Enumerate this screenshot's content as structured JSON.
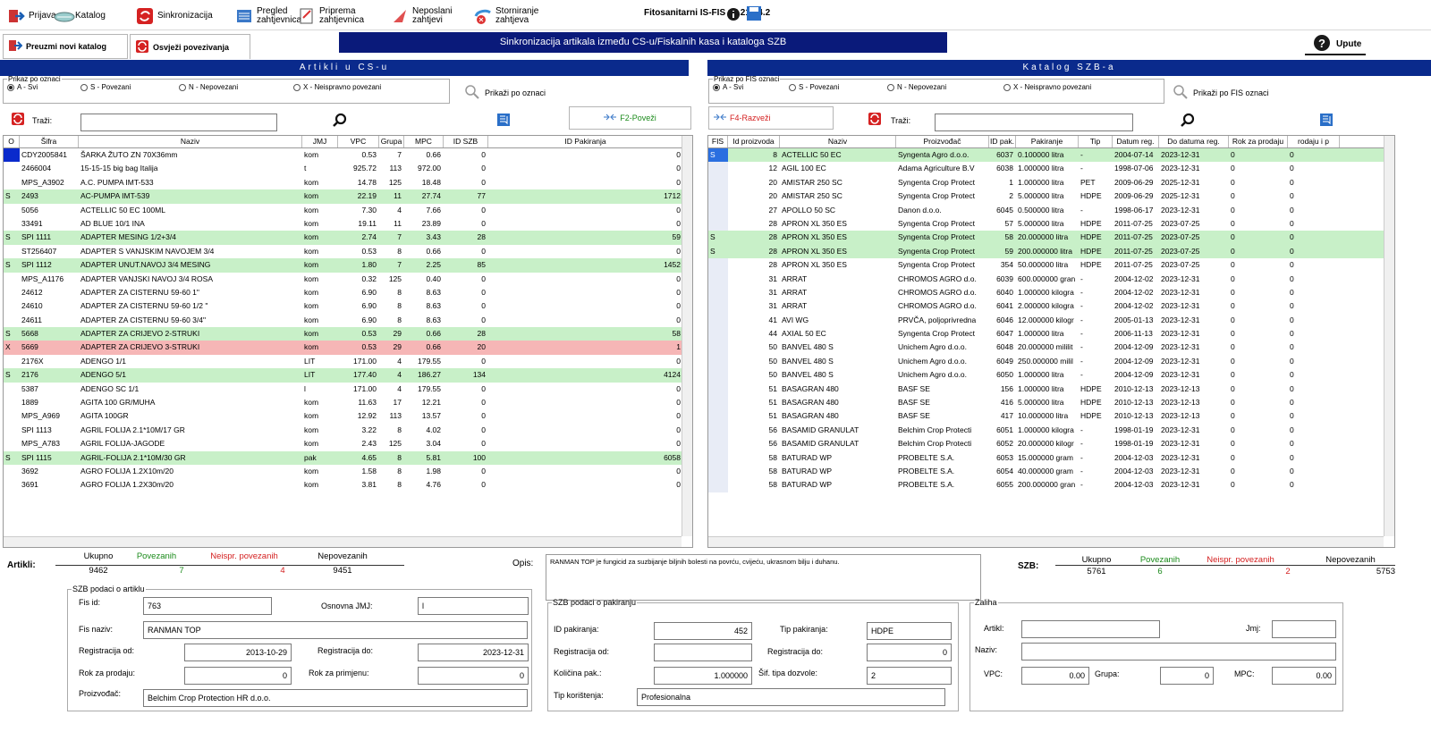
{
  "toolbar": {
    "items": [
      {
        "label": "Prijava",
        "icon": "login-icon"
      },
      {
        "label": "Katalog",
        "icon": "catalog-icon"
      },
      {
        "label": "Sinkronizacija",
        "icon": "sync-icon"
      },
      {
        "label": "Pregled\nzahtjevnica",
        "icon": "review-icon"
      },
      {
        "label": "Priprema\nzahtjevnica",
        "icon": "prepare-icon"
      },
      {
        "label": "Neposlani\nzahtjevi",
        "icon": "unsent-icon"
      },
      {
        "label": "Storniranje\nzahtjeva",
        "icon": "cancel-icon"
      }
    ],
    "app_title": "Fitosanitarni IS-FIS v5.21.04.2"
  },
  "actions": {
    "download_catalog": "Preuzmi novi katalog",
    "refresh_links": "Osvježi povezivanja",
    "help": "Upute"
  },
  "banner": "Sinkronizacija artikala između CS-u/Fiskalnih kasa i kataloga SZB",
  "left": {
    "title": "Artikli u CS-u",
    "filter_legend": "Prikaz po oznaci",
    "radios": [
      "A - Svi",
      "S - Povezani",
      "N - Nepovezani",
      "X - Neispravno povezani"
    ],
    "show_by": "Prikaži po oznaci",
    "search_label": "Traži:",
    "link_button": "F2-Poveži",
    "columns": [
      "O",
      "Šifra",
      "Naziv",
      "JMJ",
      "VPC",
      "Grupa",
      "MPC",
      "ID SZB",
      "ID Pakiranja"
    ],
    "rows": [
      [
        "",
        "CDY2005841",
        "ŠARKA ŽUTO ZN 70X36mm",
        "kom",
        "0.53",
        "7",
        "0.66",
        "0",
        "0"
      ],
      [
        "",
        "2466004",
        "15-15-15 big bag Italija",
        "t",
        "925.72",
        "113",
        "972.00",
        "0",
        "0"
      ],
      [
        "",
        "MPS_A3902",
        "A.C. PUMPA IMT-533",
        "kom",
        "14.78",
        "125",
        "18.48",
        "0",
        "0"
      ],
      [
        "S",
        "2493",
        "AC-PUMPA IMT-539",
        "kom",
        "22.19",
        "11",
        "27.74",
        "77",
        "1712"
      ],
      [
        "",
        "5056",
        "ACTELLIC 50 EC 100ML",
        "kom",
        "7.30",
        "4",
        "7.66",
        "0",
        "0"
      ],
      [
        "",
        "33491",
        "AD BLUE 10/1  INA",
        "kom",
        "19.11",
        "11",
        "23.89",
        "0",
        "0"
      ],
      [
        "S",
        "SPI 1111",
        "ADAPTER MESING 1/2+3/4",
        "kom",
        "2.74",
        "7",
        "3.43",
        "28",
        "59"
      ],
      [
        "",
        "ST256407",
        "ADAPTER S VANJSKIM NAVOJEM 3/4",
        "kom",
        "0.53",
        "8",
        "0.66",
        "0",
        "0"
      ],
      [
        "S",
        "SPI 1112",
        "ADAPTER UNUT.NAVOJ 3/4 MESING",
        "kom",
        "1.80",
        "7",
        "2.25",
        "85",
        "1452"
      ],
      [
        "",
        "MPS_A1176",
        "ADAPTER VANJSKI NAVOJ 3/4 ROSA",
        "kom",
        "0.32",
        "125",
        "0.40",
        "0",
        "0"
      ],
      [
        "",
        "24612",
        "ADAPTER ZA CISTERNU  59-60  1\"",
        "kom",
        "6.90",
        "8",
        "8.63",
        "0",
        "0"
      ],
      [
        "",
        "24610",
        "ADAPTER ZA CISTERNU  59-60  1/2 \"",
        "kom",
        "6.90",
        "8",
        "8.63",
        "0",
        "0"
      ],
      [
        "",
        "24611",
        "ADAPTER ZA CISTERNU 59-60  3/4\"",
        "kom",
        "6.90",
        "8",
        "8.63",
        "0",
        "0"
      ],
      [
        "S",
        "5668",
        "ADAPTER ZA CRIJEVO 2-STRUKI",
        "kom",
        "0.53",
        "29",
        "0.66",
        "28",
        "58"
      ],
      [
        "X",
        "5669",
        "ADAPTER ZA CRIJEVO 3-STRUKI",
        "kom",
        "0.53",
        "29",
        "0.66",
        "20",
        "1"
      ],
      [
        "",
        "2176X",
        "ADENGO  1/1",
        "LIT",
        "171.00",
        "4",
        "179.55",
        "0",
        "0"
      ],
      [
        "S",
        "2176",
        "ADENGO 5/1",
        "LIT",
        "177.40",
        "4",
        "186.27",
        "134",
        "4124"
      ],
      [
        "",
        "5387",
        "ADENGO SC 1/1",
        "l",
        "171.00",
        "4",
        "179.55",
        "0",
        "0"
      ],
      [
        "",
        "1889",
        "AGITA 100 GR/MUHA",
        "kom",
        "11.63",
        "17",
        "12.21",
        "0",
        "0"
      ],
      [
        "",
        "MPS_A969",
        "AGITA 100GR",
        "kom",
        "12.92",
        "113",
        "13.57",
        "0",
        "0"
      ],
      [
        "",
        "SPI 1113",
        "AGRIL FOLIJA 2.1*10M/17 GR",
        "kom",
        "3.22",
        "8",
        "4.02",
        "0",
        "0"
      ],
      [
        "",
        "MPS_A783",
        "AGRIL FOLIJA-JAGODE",
        "kom",
        "2.43",
        "125",
        "3.04",
        "0",
        "0"
      ],
      [
        "S",
        "SPI 1115",
        "AGRIL-FOLIJA 2.1*10M/30 GR",
        "pak",
        "4.65",
        "8",
        "5.81",
        "100",
        "6058"
      ],
      [
        "",
        "3692",
        "AGRO FOLIJA 1.2X10m/20",
        "kom",
        "1.58",
        "8",
        "1.98",
        "0",
        "0"
      ],
      [
        "",
        "3691",
        "AGRO FOLIJA 1.2X30m/20",
        "kom",
        "3.81",
        "8",
        "4.76",
        "0",
        "0"
      ]
    ],
    "stats": {
      "label": "Artikli:",
      "h": [
        "Ukupno",
        "Povezanih",
        "Neispr. povezanih",
        "Nepovezanih"
      ],
      "v": [
        "9462",
        "7",
        "4",
        "9451"
      ]
    }
  },
  "right": {
    "title": "Katalog SZB-a",
    "filter_legend": "Prikaz po FIS oznaci",
    "radios": [
      "A - Svi",
      "S - Povezani",
      "N - Nepovezani",
      "X - Neispravno povezani"
    ],
    "show_by": "Prikaži po FIS oznaci",
    "unlink_button": "F4-Razveži",
    "search_label": "Traži:",
    "columns": [
      "FIS",
      "Id proizvoda",
      "Naziv",
      "Proizvođač",
      "ID pak.",
      "Pakiranje",
      "Tip",
      "Datum reg.",
      "Do datuma reg.",
      "Rok za prodaju",
      "rodaju i p"
    ],
    "rows": [
      [
        "S",
        "8",
        "ACTELLIC 50 EC",
        "Syngenta Agro d.o.o.",
        "6037",
        "0.100000 litra",
        "-",
        "2004-07-14",
        "2023-12-31",
        "0",
        "0"
      ],
      [
        "",
        "12",
        "AGIL 100 EC",
        "Adama Agriculture B.V",
        "6038",
        "1.000000 litra",
        "-",
        "1998-07-06",
        "2023-12-31",
        "0",
        "0"
      ],
      [
        "",
        "20",
        "AMISTAR 250 SC",
        "Syngenta Crop Protect",
        "1",
        "1.000000 litra",
        "PET",
        "2009-06-29",
        "2025-12-31",
        "0",
        "0"
      ],
      [
        "",
        "20",
        "AMISTAR 250 SC",
        "Syngenta Crop Protect",
        "2",
        "5.000000 litra",
        "HDPE",
        "2009-06-29",
        "2025-12-31",
        "0",
        "0"
      ],
      [
        "",
        "27",
        "APOLLO 50 SC",
        "Danon d.o.o.",
        "6045",
        "0.500000 litra",
        "-",
        "1998-06-17",
        "2023-12-31",
        "0",
        "0"
      ],
      [
        "",
        "28",
        "APRON XL 350 ES",
        "Syngenta Crop Protect",
        "57",
        "5.000000 litra",
        "HDPE",
        "2011-07-25",
        "2023-07-25",
        "0",
        "0"
      ],
      [
        "S",
        "28",
        "APRON XL 350 ES",
        "Syngenta Crop Protect",
        "58",
        "20.000000 litra",
        "HDPE",
        "2011-07-25",
        "2023-07-25",
        "0",
        "0"
      ],
      [
        "S",
        "28",
        "APRON XL 350 ES",
        "Syngenta Crop Protect",
        "59",
        "200.000000 litra",
        "HDPE",
        "2011-07-25",
        "2023-07-25",
        "0",
        "0"
      ],
      [
        "",
        "28",
        "APRON XL 350 ES",
        "Syngenta Crop Protect",
        "354",
        "50.000000 litra",
        "HDPE",
        "2011-07-25",
        "2023-07-25",
        "0",
        "0"
      ],
      [
        "",
        "31",
        "ARRAT",
        "CHROMOS AGRO d.o.",
        "6039",
        "600.000000 gran",
        "-",
        "2004-12-02",
        "2023-12-31",
        "0",
        "0"
      ],
      [
        "",
        "31",
        "ARRAT",
        "CHROMOS AGRO d.o.",
        "6040",
        "1.000000 kilogra",
        "-",
        "2004-12-02",
        "2023-12-31",
        "0",
        "0"
      ],
      [
        "",
        "31",
        "ARRAT",
        "CHROMOS AGRO d.o.",
        "6041",
        "2.000000 kilogra",
        "-",
        "2004-12-02",
        "2023-12-31",
        "0",
        "0"
      ],
      [
        "",
        "41",
        "AVI WG",
        "PRVČA, poljoprivredna",
        "6046",
        "12.000000 kilogr",
        "-",
        "2005-01-13",
        "2023-12-31",
        "0",
        "0"
      ],
      [
        "",
        "44",
        "AXIAL 50 EC",
        "Syngenta Crop Protect",
        "6047",
        "1.000000 litra",
        "-",
        "2006-11-13",
        "2023-12-31",
        "0",
        "0"
      ],
      [
        "",
        "50",
        "BANVEL 480 S",
        "Unichem Agro d.o.o.",
        "6048",
        "20.000000 mililit",
        "-",
        "2004-12-09",
        "2023-12-31",
        "0",
        "0"
      ],
      [
        "",
        "50",
        "BANVEL 480 S",
        "Unichem Agro d.o.o.",
        "6049",
        "250.000000 milil",
        "-",
        "2004-12-09",
        "2023-12-31",
        "0",
        "0"
      ],
      [
        "",
        "50",
        "BANVEL 480 S",
        "Unichem Agro d.o.o.",
        "6050",
        "1.000000 litra",
        "-",
        "2004-12-09",
        "2023-12-31",
        "0",
        "0"
      ],
      [
        "",
        "51",
        "BASAGRAN 480",
        "BASF SE",
        "156",
        "1.000000 litra",
        "HDPE",
        "2010-12-13",
        "2023-12-13",
        "0",
        "0"
      ],
      [
        "",
        "51",
        "BASAGRAN 480",
        "BASF SE",
        "416",
        "5.000000 litra",
        "HDPE",
        "2010-12-13",
        "2023-12-13",
        "0",
        "0"
      ],
      [
        "",
        "51",
        "BASAGRAN 480",
        "BASF SE",
        "417",
        "10.000000 litra",
        "HDPE",
        "2010-12-13",
        "2023-12-13",
        "0",
        "0"
      ],
      [
        "",
        "56",
        "BASAMID GRANULAT",
        "Belchim Crop Protecti",
        "6051",
        "1.000000 kilogra",
        "-",
        "1998-01-19",
        "2023-12-31",
        "0",
        "0"
      ],
      [
        "",
        "56",
        "BASAMID GRANULAT",
        "Belchim Crop Protecti",
        "6052",
        "20.000000 kilogr",
        "-",
        "1998-01-19",
        "2023-12-31",
        "0",
        "0"
      ],
      [
        "",
        "58",
        "BATURAD WP",
        "PROBELTE S.A.",
        "6053",
        "15.000000 gram",
        "-",
        "2004-12-03",
        "2023-12-31",
        "0",
        "0"
      ],
      [
        "",
        "58",
        "BATURAD WP",
        "PROBELTE S.A.",
        "6054",
        "40.000000 gram",
        "-",
        "2004-12-03",
        "2023-12-31",
        "0",
        "0"
      ],
      [
        "",
        "58",
        "BATURAD WP",
        "PROBELTE S.A.",
        "6055",
        "200.000000 gran",
        "-",
        "2004-12-03",
        "2023-12-31",
        "0",
        "0"
      ]
    ],
    "stats": {
      "label": "SZB:",
      "h": [
        "Ukupno",
        "Povezanih",
        "Neispr. povezanih",
        "Nepovezanih"
      ],
      "v": [
        "5761",
        "6",
        "2",
        "5753"
      ]
    }
  },
  "opis": {
    "label": "Opis:",
    "text": "RANMAN TOP je fungicid za suzbijanje biljnih bolesti na povrću, cvijeću, ukrasnom bilju i duhanu."
  },
  "szb_article": {
    "legend": "SZB podaci o artiklu",
    "fis_id_label": "Fis id:",
    "fis_id": "763",
    "jmj_label": "Osnovna JMJ:",
    "jmj": "l",
    "fis_name_label": "Fis naziv:",
    "fis_name": "RANMAN TOP",
    "reg_from_label": "Registracija od:",
    "reg_from": "2013-10-29",
    "reg_to_label": "Registracija do:",
    "reg_to": "2023-12-31",
    "sale_label": "Rok za prodaju:",
    "sale": "0",
    "use_label": "Rok za primjenu:",
    "use": "0",
    "producer_label": "Proizvođač:",
    "producer": "Belchim Crop Protection HR d.o.o."
  },
  "szb_pack": {
    "legend": "SZB podaci o pakiranju",
    "id_label": "ID pakiranja:",
    "id": "452",
    "type_label": "Tip pakiranja:",
    "type": "HDPE",
    "reg_from_label": "Registracija od:",
    "reg_from": "",
    "reg_to_label": "Registracija do:",
    "reg_to": "0",
    "qty_label": "Količina pak.:",
    "qty": "1.000000",
    "permit_label": "Šif. tipa dozvole:",
    "permit": "2",
    "usage_label": "Tip korištenja:",
    "usage": "Profesionalna"
  },
  "stock": {
    "legend": "Zaliha",
    "article_label": "Artikl:",
    "jmj_label": "Jmj:",
    "name_label": "Naziv:",
    "vpc_label": "VPC:",
    "vpc": "0.00",
    "group_label": "Grupa:",
    "group": "0",
    "mpc_label": "MPC:",
    "mpc": "0.00"
  },
  "colors": {
    "navy": "#0a2a8c",
    "linked": "#c8f0c8",
    "bad": "#f6b6b6",
    "stat_green": "#1a8a1a",
    "stat_red": "#d42020"
  }
}
